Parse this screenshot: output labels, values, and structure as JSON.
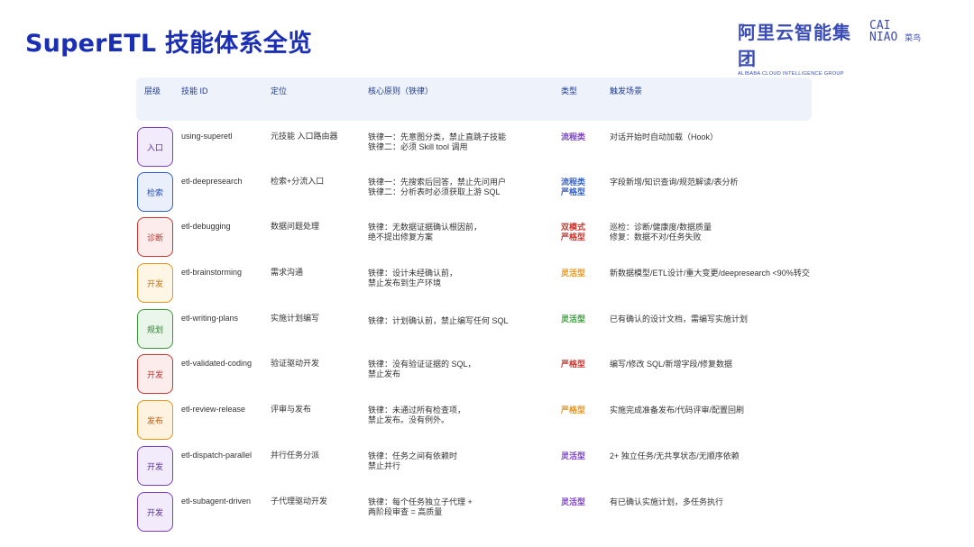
{
  "title": "SuperETL 技能体系全览",
  "logo_alibaba": {
    "cn": "阿里云智能集团",
    "en": "ALIBABA CLOUD INTELLIGENCE GROUP"
  },
  "logo_cainiao": {
    "line1": "CAI",
    "line2": "NIAO",
    "cn": "菜鸟"
  },
  "columns": [
    "层级",
    "技能 ID",
    "定位",
    "核心原则（铁律）",
    "类型",
    "触发场景"
  ],
  "rows": [
    {
      "layer": "入口",
      "id": "using-superetl",
      "position": "元技能 入口路由器",
      "principle1": "铁律一：先意图分类，禁止直跳子技能",
      "principle2": "铁律二：必须 Skill tool 调用",
      "type1": "流程类",
      "type2": "",
      "trigger1": "对话开始时自动加载（Hook）",
      "trigger2": ""
    },
    {
      "layer": "检索",
      "id": "etl-deepresearch",
      "position": "检索+分流入口",
      "principle1": "铁律一：先搜索后回答，禁止先问用户",
      "principle2": "铁律二：分析表时必须获取上游 SQL",
      "type1": "流程类",
      "type2": "严格型",
      "trigger1": "字段新增/知识查询/规范解读/表分析",
      "trigger2": ""
    },
    {
      "layer": "诊断",
      "id": "etl-debugging",
      "position": "数据问题处理",
      "principle1": "铁律：无数据证据确认根因前，",
      "principle2": "绝不提出修复方案",
      "type1": "双模式",
      "type2": "严格型",
      "trigger1": "巡检：诊断/健康度/数据质量",
      "trigger2": "修复：数据不对/任务失败"
    },
    {
      "layer": "开发",
      "id": "etl-brainstorming",
      "position": "需求沟通",
      "principle1": "铁律：设计未经确认前，",
      "principle2": "禁止发布到生产环境",
      "type1": "灵活型",
      "type2": "",
      "trigger1": "新数据模型/ETL设计/重大变更/deepresearch <90%转交",
      "trigger2": ""
    },
    {
      "layer": "规划",
      "id": "etl-writing-plans",
      "position": "实施计划编写",
      "principle1": "铁律：计划确认前，禁止编写任何 SQL",
      "principle2": "",
      "type1": "灵活型",
      "type2": "",
      "trigger1": "已有确认的设计文档，需编写实施计划",
      "trigger2": ""
    },
    {
      "layer": "开发",
      "id": "etl-validated-coding",
      "position": "验证驱动开发",
      "principle1": "铁律：没有验证证据的 SQL，",
      "principle2": "禁止发布",
      "type1": "严格型",
      "type2": "",
      "trigger1": "编写/修改 SQL/新增字段/修复数据",
      "trigger2": ""
    },
    {
      "layer": "发布",
      "id": "etl-review-release",
      "position": "评审与发布",
      "principle1": "铁律：未通过所有检查项，",
      "principle2": "禁止发布。没有例外。",
      "type1": "严格型",
      "type2": "",
      "trigger1": "实施完成准备发布/代码评审/配置回刷",
      "trigger2": ""
    },
    {
      "layer": "开发",
      "id": "etl-dispatch-parallel",
      "position": "并行任务分派",
      "principle1": "铁律：任务之间有依赖时",
      "principle2": "禁止并行",
      "type1": "灵活型",
      "type2": "",
      "trigger1": "2+ 独立任务/无共享状态/无顺序依赖",
      "trigger2": ""
    },
    {
      "layer": "开发",
      "id": "etl-subagent-driven",
      "position": "子代理驱动开发",
      "principle1": "铁律：每个任务独立子代理 +",
      "principle2": "两阶段审查 = 高质量",
      "type1": "灵活型",
      "type2": "",
      "trigger1": "有已确认实施计划，多任务执行",
      "trigger2": ""
    }
  ],
  "colors": {
    "title": "#1a2fb3",
    "purple": "#7b3fc6",
    "blue": "#3060d0",
    "red": "#d0342c",
    "orange": "#e8951a",
    "green": "#3a9a3a"
  }
}
